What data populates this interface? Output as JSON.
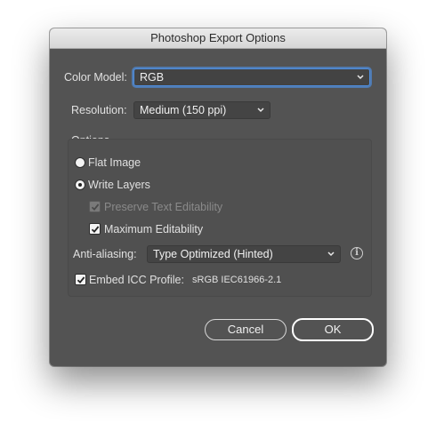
{
  "window": {
    "title": "Photoshop Export Options"
  },
  "color_model": {
    "label": "Color Model:",
    "value": "RGB"
  },
  "resolution": {
    "label": "Resolution:",
    "value": "Medium (150 ppi)"
  },
  "options": {
    "title": "Options",
    "flat_image": {
      "label": "Flat Image",
      "selected": false
    },
    "write_layers": {
      "label": "Write Layers",
      "selected": true
    },
    "preserve_text": {
      "label": "Preserve Text Editability",
      "checked": true,
      "disabled": true
    },
    "max_edit": {
      "label": "Maximum Editability",
      "checked": true
    },
    "anti_aliasing": {
      "label": "Anti-aliasing:",
      "value": "Type Optimized (Hinted)"
    },
    "embed_icc": {
      "label": "Embed ICC Profile:",
      "checked": true,
      "profile": "sRGB IEC61966-2.1"
    }
  },
  "buttons": {
    "cancel": "Cancel",
    "ok": "OK"
  },
  "icons": {
    "info": "info-icon",
    "chevron": "chevron-down-icon",
    "check": "checkmark-icon"
  }
}
